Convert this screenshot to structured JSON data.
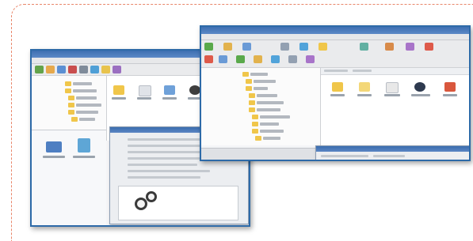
{
  "back_window": {
    "title": "",
    "menu": [
      "",
      "",
      "",
      "",
      ""
    ],
    "toolbar_colors": [
      "#63a34a",
      "#e6a94c",
      "#5b8fd3",
      "#c94e4e",
      "#7f8b9a",
      "#4f9fd6",
      "#e8c34d",
      "#9b6fc1"
    ],
    "icon_colors": [
      "#f0c64a",
      "#e0e3e8",
      "#6fa1d9",
      "#3e3e3e",
      "#d9573d"
    ]
  },
  "front_window": {
    "title": "",
    "menu": [
      "",
      "",
      "",
      "",
      "",
      ""
    ],
    "toolbar_colors": [
      "#5aa94b",
      "#e2b24d",
      "#6a9ad6",
      "#de5a4a",
      "#93a0b1",
      "#51a3da",
      "#f0c64a",
      "#a874c9",
      "#62b0a2",
      "#d88b4a"
    ],
    "tree_items": [
      "",
      "",
      "",
      "",
      "",
      "",
      "",
      "",
      "",
      ""
    ],
    "icon_colors": [
      "#f0c64a",
      "#f3d778",
      "#e8e8e8",
      "#2e3a4f",
      "#d9573d"
    ],
    "dialog_title": ""
  },
  "colors": {
    "frame_dash": "#e9866a",
    "window_border": "#2d6aa8",
    "titlebar": "#3d6fb1"
  }
}
